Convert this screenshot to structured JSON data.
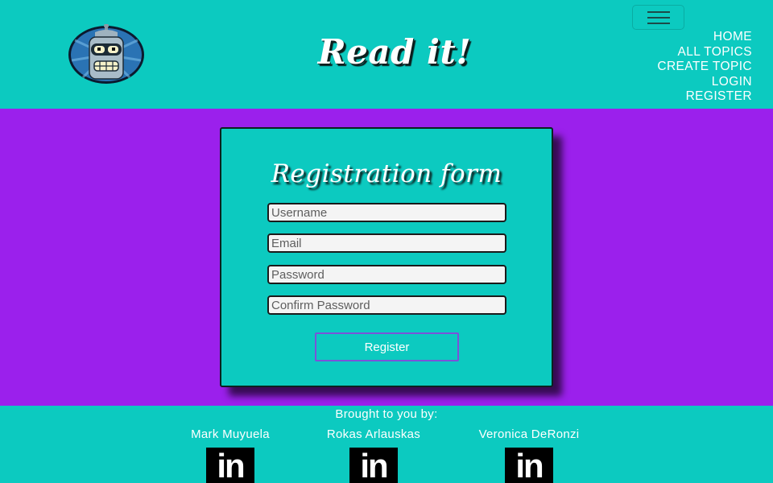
{
  "header": {
    "brand": "Read it!",
    "logo_icon": "robot-avatar-icon",
    "menu_icon": "hamburger-menu-icon",
    "nav": [
      {
        "label": "HOME"
      },
      {
        "label": "ALL TOPICS"
      },
      {
        "label": "CREATE TOPIC"
      },
      {
        "label": "LOGIN"
      },
      {
        "label": "REGISTER"
      }
    ]
  },
  "form": {
    "title": "Registration form",
    "fields": {
      "username": {
        "placeholder": "Username",
        "value": ""
      },
      "email": {
        "placeholder": "Email",
        "value": ""
      },
      "password": {
        "placeholder": "Password",
        "value": ""
      },
      "confirm_password": {
        "placeholder": "Confirm Password",
        "value": ""
      }
    },
    "submit_label": "Register"
  },
  "footer": {
    "title": "Brought to you by:",
    "credits": [
      {
        "name": "Mark Muyuela",
        "icon": "linkedin-icon",
        "icon_text": "in"
      },
      {
        "name": "Rokas Arlauskas",
        "icon": "linkedin-icon",
        "icon_text": "in"
      },
      {
        "name": "Veronica DeRonzi",
        "icon": "linkedin-icon",
        "icon_text": "in"
      }
    ]
  },
  "colors": {
    "teal": "#0ccac0",
    "purple": "#9b20ec",
    "button_border": "#7b52d9"
  }
}
